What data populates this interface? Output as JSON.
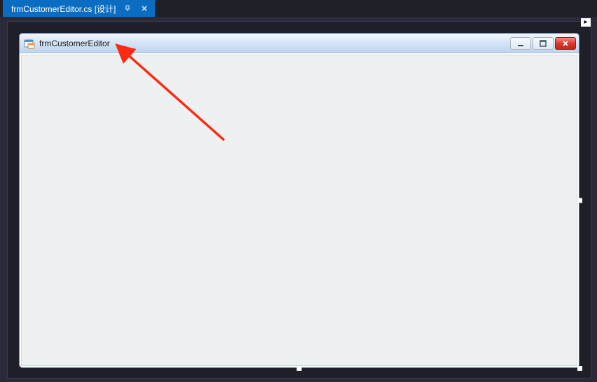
{
  "tab": {
    "label": "frmCustomerEditor.cs [设计]"
  },
  "form": {
    "title": "frmCustomerEditor"
  },
  "icons": {
    "pin": "pin-icon",
    "close_tab": "close-icon",
    "overflow": "▸",
    "form_app": "winforms-app-icon",
    "minimize": "minimize-icon",
    "maximize": "maximize-icon",
    "close": "close-icon"
  },
  "colors": {
    "tab_active": "#0b6dc2",
    "designer_bg": "#1f1f2a",
    "form_client": "#eef1f2",
    "titlebar_top": "#f3f7fc",
    "titlebar_bottom": "#bcd4ee",
    "close_btn": "#d93a2b",
    "arrow": "#ff2a12"
  }
}
